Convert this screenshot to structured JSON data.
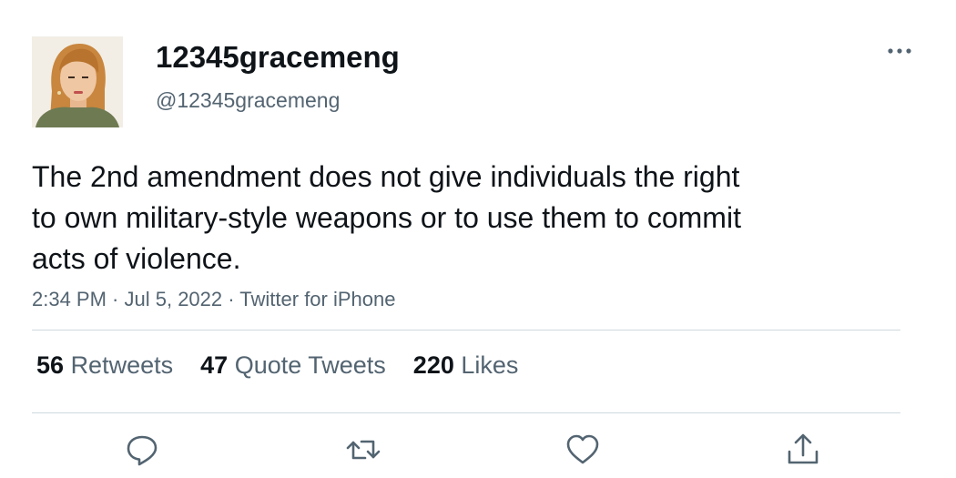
{
  "author": {
    "display_name": "12345gracemeng",
    "handle": "@12345gracemeng"
  },
  "tweet": {
    "lines": [
      "The 2nd amendment does not give individuals the right",
      "to own military-style weapons or to use them to commit",
      "acts of violence."
    ],
    "time": "2:34 PM",
    "date": "Jul 5, 2022",
    "source": "Twitter for iPhone",
    "separator": " · "
  },
  "stats": {
    "retweets_count": "56",
    "retweets_label": "Retweets",
    "quote_count": "47",
    "quote_label": "Quote Tweets",
    "likes_count": "220",
    "likes_label": "Likes"
  },
  "actions": [
    {
      "icon": "reply-icon"
    },
    {
      "icon": "retweet-icon"
    },
    {
      "icon": "like-icon"
    },
    {
      "icon": "share-icon"
    }
  ],
  "colors": {
    "text": "#0f1419",
    "secondary": "#536471",
    "divider": "#cfd9de"
  }
}
